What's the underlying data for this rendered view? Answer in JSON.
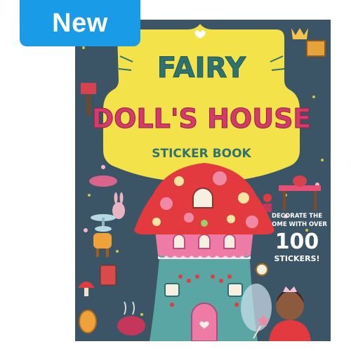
{
  "badge": {
    "label": "New"
  },
  "cover": {
    "title_line1": "FAIRY",
    "title_line2": "DOLL'S HOUSE",
    "subtitle": "STICKER BOOK",
    "promo_line1": "DECORATE THE",
    "promo_line2": "HOME WITH OVER",
    "promo_number": "100",
    "promo_line3": "STICKERS!"
  },
  "colors": {
    "badge": "#1a9be8",
    "cover_background": "#3c5566",
    "cloud_yellow": "#f3e24a",
    "title_teal": "#2f7272",
    "title_pink": "#d63a6a",
    "mushroom_red": "#e23a3f",
    "house_pink": "#ee7aa6",
    "stem_teal": "#5aa6a4"
  },
  "icons": [
    "heart-icon",
    "crown-icon",
    "star-icon",
    "teapot-icon",
    "flower-icon",
    "bunny-icon",
    "fairy-icon"
  ]
}
